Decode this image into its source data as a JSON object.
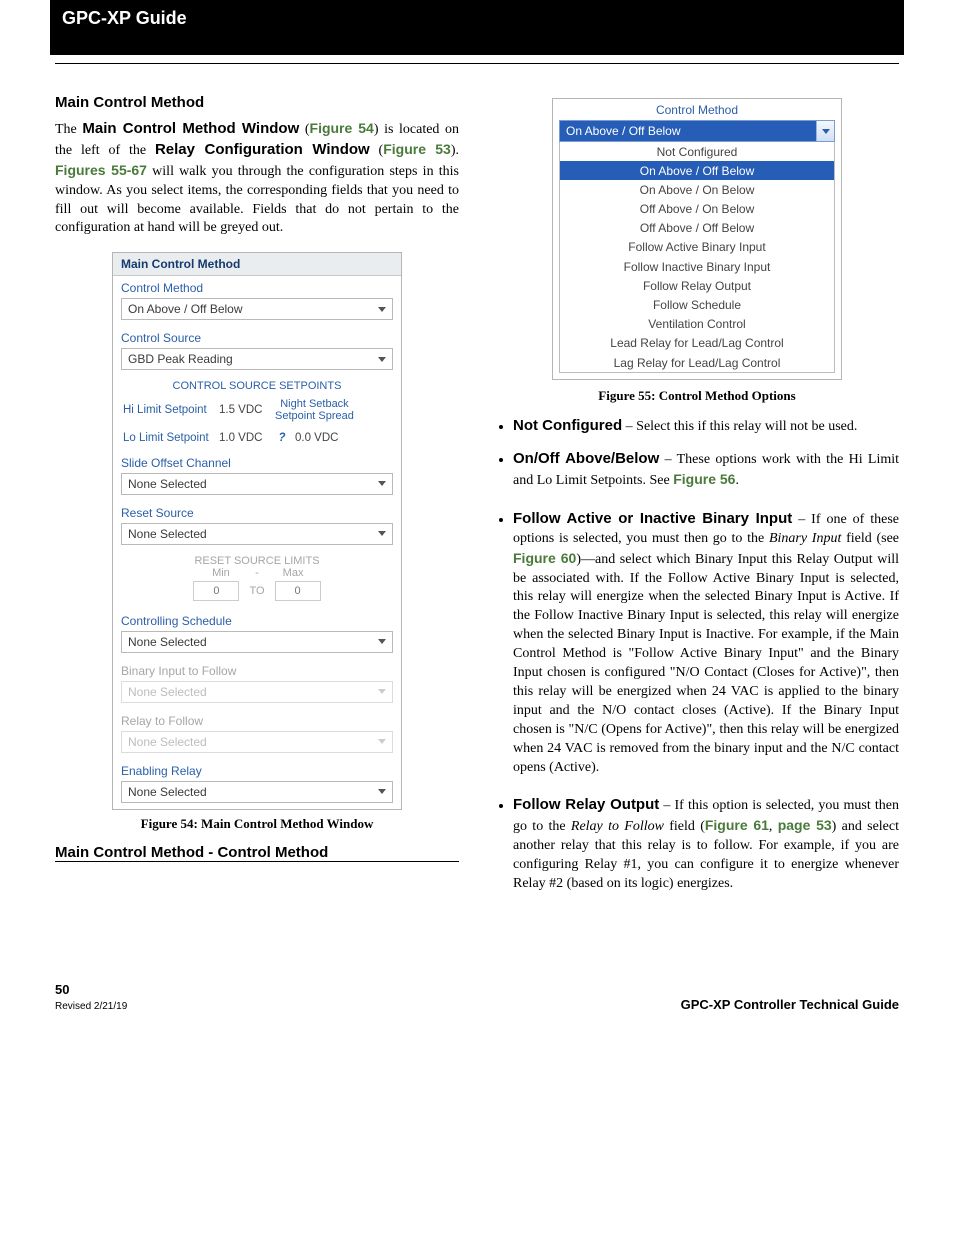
{
  "header": {
    "title": "GPC-XP Guide"
  },
  "left": {
    "section_heading": "Main Control Method",
    "intro": {
      "t1": "The ",
      "b1": "Main Control Method Window",
      "t2": " (",
      "b2": "Figure 54",
      "t3": ") is located on the left of the ",
      "b3": "Relay Configuration Window",
      "t4": " (",
      "b4": "Figure 53",
      "t5": "). ",
      "b5": "Figures 55-67",
      "t6": " will walk you through the configuration steps in this window. As you select items, the corresponding fields that you need to fill out will become available. Fields that do not pertain to the configuration at hand will be greyed out."
    },
    "panel": {
      "title": "Main Control Method",
      "l_cm": "Control Method",
      "v_cm": "On Above / Off Below",
      "l_cs": "Control Source",
      "v_cs": "GBD Peak Reading",
      "grp_css": "CONTROL SOURCE SETPOINTS",
      "l_hi": "Hi Limit Setpoint",
      "v_hi": "1.5 VDC",
      "l_nsb1": "Night Setback",
      "l_nsb2": "Setpoint Spread",
      "l_lo": "Lo Limit Setpoint",
      "v_lo": "1.0 VDC",
      "v_nsb": "0.0 VDC",
      "l_so": "Slide Offset Channel",
      "v_so": "None Selected",
      "l_rs": "Reset Source",
      "v_rs": "None Selected",
      "grp_rsl": "RESET SOURCE LIMITS",
      "min": "Min",
      "dash": "-",
      "max": "Max",
      "v_min": "0",
      "to": "TO",
      "v_max": "0",
      "l_sched": "Controlling Schedule",
      "v_sched": "None Selected",
      "l_bif": "Binary Input to Follow",
      "v_bif": "None Selected",
      "l_rtf": "Relay to Follow",
      "v_rtf": "None Selected",
      "l_er": "Enabling Relay",
      "v_er": "None Selected"
    },
    "fig54": "Figure 54: Main Control Method Window",
    "subheading": "Main Control Method - Control Method"
  },
  "right": {
    "cm_panel": {
      "label": "Control Method",
      "selected": "On Above / Off Below",
      "opts": [
        {
          "t": "Not Configured",
          "hl": false
        },
        {
          "t": "On Above / Off Below",
          "hl": true
        },
        {
          "t": "On Above / On Below",
          "hl": false
        },
        {
          "t": "Off Above / On Below",
          "hl": false
        },
        {
          "t": "Off Above / Off Below",
          "hl": false
        },
        {
          "t": "Follow Active Binary Input",
          "hl": false
        },
        {
          "t": "Follow Inactive Binary Input",
          "hl": false
        },
        {
          "t": "Follow Relay Output",
          "hl": false
        },
        {
          "t": "Follow Schedule",
          "hl": false
        },
        {
          "t": "Ventilation Control",
          "hl": false
        },
        {
          "t": "Lead Relay for Lead/Lag Control",
          "hl": false
        },
        {
          "t": "Lag Relay for Lead/Lag Control",
          "hl": false
        }
      ]
    },
    "fig55": "Figure 55: Control Method Options",
    "bullets": {
      "b1": {
        "head": "Not Configured",
        "tail": " – Select this if this relay will not be used."
      },
      "b2": {
        "head": "On/Off Above/Below",
        "mid": " – These options work with the Hi Limit and Lo Limit Setpoints. See ",
        "link": "Figure 56",
        "end": "."
      },
      "b3": {
        "head": "Follow Active or Inactive Binary Input",
        "t1": " – If one of these options is selected, you must then go to the ",
        "em1": "Binary Input",
        "t2": " field (see ",
        "link1": "Figure 60",
        "t3": ")—and select which Binary Input this Relay Output will be associated with. If the Follow Active Binary Input is selected, this relay will energize when the selected Binary Input is Active.  If the Follow Inactive Binary Input is selected, this relay will energize when the selected Binary Input is Inactive.  For example, if the Main Control Method is \"Follow Active Binary Input\" and the Binary Input chosen is configured \"N/O Contact (Closes for Active)\", then this relay will be energized when 24 VAC is applied to the binary input and the N/O contact closes (Active).  If the Binary Input chosen is \"N/C (Opens for Active)\", then this relay will be energized when 24 VAC is removed from the binary input and the N/C contact opens (Active)."
      },
      "b4": {
        "head": "Follow Relay Output",
        "t1": " – If this option is selected, you must then go to the ",
        "em1": "Relay to Follow",
        "t2": " field (",
        "link1": "Figure 61",
        "comma": ", ",
        "link2": "page 53",
        "t3": ") and select another relay that this relay is to follow.  For example, if you are configuring Relay #1, you can configure it to energize whenever Relay #2 (based on its logic) energizes."
      }
    }
  },
  "footer": {
    "pg": "50",
    "rev": "Revised 2/21/19",
    "running": "GPC-XP Controller Technical Guide"
  }
}
